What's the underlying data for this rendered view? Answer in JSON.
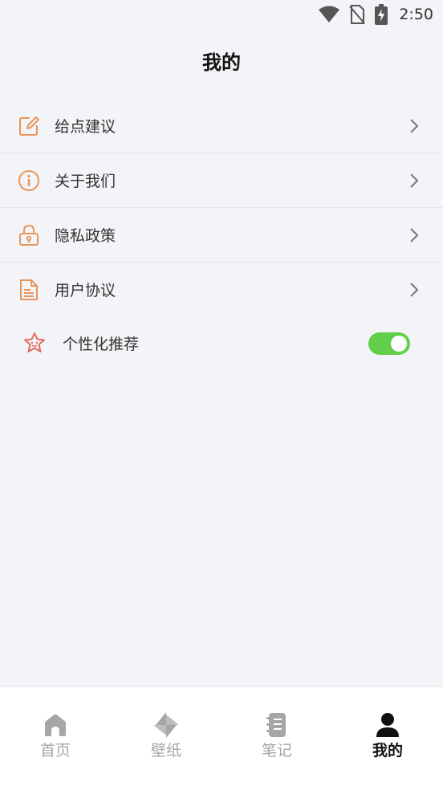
{
  "status": {
    "time": "2:50"
  },
  "page": {
    "title": "我的"
  },
  "menu": [
    {
      "label": "给点建议",
      "icon": "edit-icon"
    },
    {
      "label": "关于我们",
      "icon": "info-icon"
    },
    {
      "label": "隐私政策",
      "icon": "lock-icon"
    },
    {
      "label": "用户协议",
      "icon": "document-icon"
    }
  ],
  "personalization": {
    "label": "个性化推荐",
    "icon": "star-icon",
    "enabled": true
  },
  "tabs": [
    {
      "label": "首页",
      "icon": "home-icon",
      "active": false
    },
    {
      "label": "壁纸",
      "icon": "pinwheel-icon",
      "active": false
    },
    {
      "label": "笔记",
      "icon": "notebook-icon",
      "active": false
    },
    {
      "label": "我的",
      "icon": "person-icon",
      "active": true
    }
  ],
  "colors": {
    "accent": "#e9955a",
    "toggle_on": "#62cf4a",
    "active_tab": "#111111",
    "inactive_tab": "#a6a6a6"
  }
}
